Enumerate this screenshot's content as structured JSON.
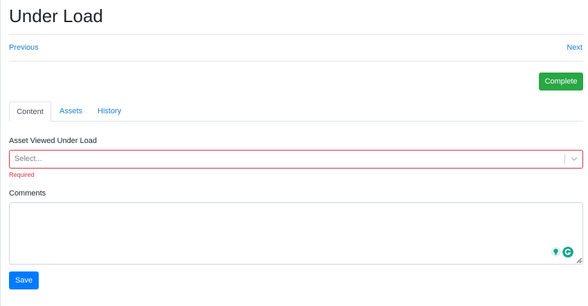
{
  "page": {
    "title": "Under Load"
  },
  "pager": {
    "previous_label": "Previous",
    "next_label": "Next"
  },
  "actions": {
    "complete_label": "Complete",
    "save_label": "Save"
  },
  "tabs": [
    {
      "label": "Content",
      "active": true
    },
    {
      "label": "Assets",
      "active": false
    },
    {
      "label": "History",
      "active": false
    }
  ],
  "form": {
    "asset_field": {
      "label": "Asset Viewed Under Load",
      "placeholder": "Select...",
      "value": "",
      "validation_message": "Required"
    },
    "comments_field": {
      "label": "Comments",
      "value": ""
    }
  },
  "icons": {
    "select_indicator": "chevron-down-icon",
    "assistant_suggestion": "lightbulb-icon",
    "assistant_logo": "grammarly-icon"
  },
  "colors": {
    "link": "#1a7fd4",
    "complete_button": "#28a745",
    "save_button": "#007bff",
    "error": "#c8334a",
    "assistant": "#15a589"
  }
}
